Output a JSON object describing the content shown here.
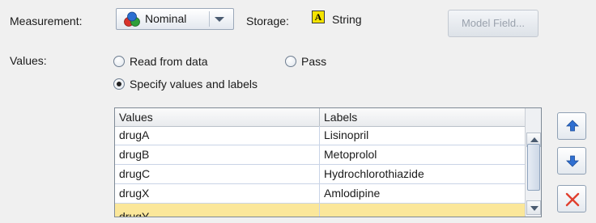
{
  "measurement": {
    "label": "Measurement:",
    "selected": "Nominal",
    "icon": "nominal-measure-icon"
  },
  "storage": {
    "label": "Storage:",
    "icon_glyph": "A",
    "value": "String"
  },
  "model_field_button": "Model Field...",
  "values_section": {
    "label": "Values:",
    "options": [
      {
        "label": "Read from data",
        "selected": false
      },
      {
        "label": "Pass",
        "selected": false
      },
      {
        "label": "Specify values and labels",
        "selected": true
      }
    ]
  },
  "table": {
    "columns": [
      "Values",
      "Labels"
    ],
    "rows": [
      {
        "value": "drugA",
        "label": "Lisinopril"
      },
      {
        "value": "drugB",
        "label": "Metoprolol"
      },
      {
        "value": "drugC",
        "label": "Hydrochlorothiazide"
      },
      {
        "value": "drugX",
        "label": "Amlodipine"
      },
      {
        "value": "drugY",
        "label": ""
      }
    ],
    "selected_row_color": "#fbe79a"
  },
  "side_buttons": [
    {
      "icon": "move-up-icon"
    },
    {
      "icon": "move-down-icon"
    },
    {
      "icon": "delete-icon"
    }
  ]
}
